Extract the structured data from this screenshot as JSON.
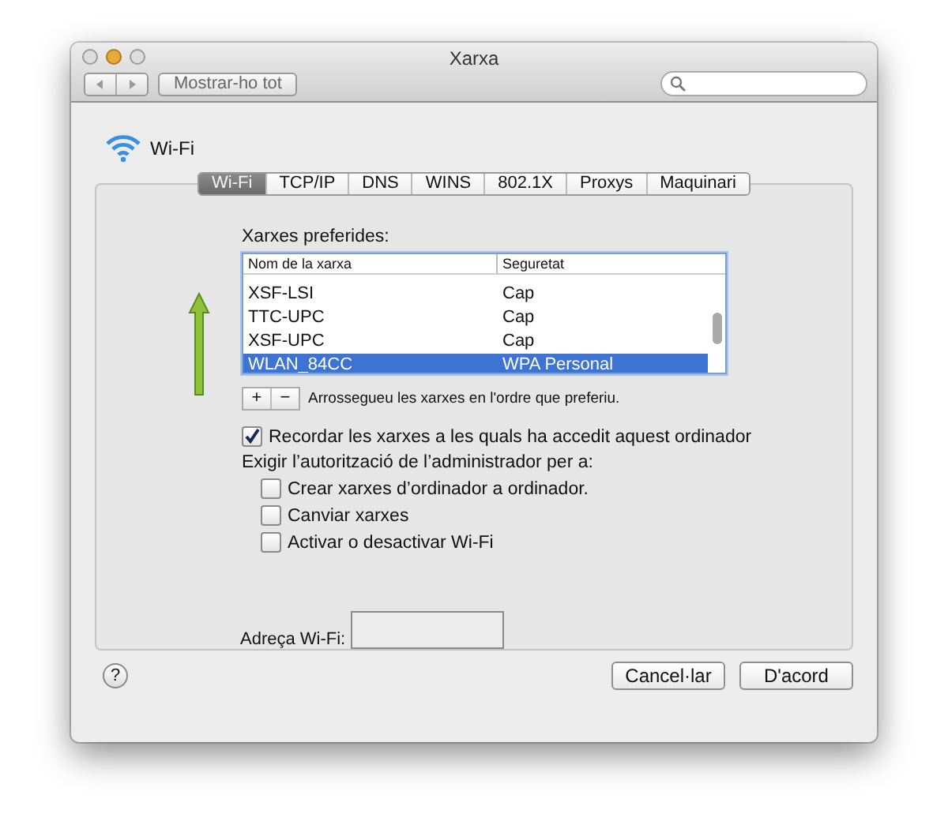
{
  "window": {
    "title": "Xarxa"
  },
  "toolbar": {
    "show_all": "Mostrar-ho tot"
  },
  "service": {
    "name": "Wi-Fi"
  },
  "tabs": [
    {
      "label": "Wi-Fi",
      "selected": true
    },
    {
      "label": "TCP/IP",
      "selected": false
    },
    {
      "label": "DNS",
      "selected": false
    },
    {
      "label": "WINS",
      "selected": false
    },
    {
      "label": "802.1X",
      "selected": false
    },
    {
      "label": "Proxys",
      "selected": false
    },
    {
      "label": "Maquinari",
      "selected": false
    }
  ],
  "preferred_networks": {
    "label": "Xarxes preferides:",
    "columns": [
      "Nom de la xarxa",
      "Seguretat"
    ],
    "rows": [
      {
        "name": "XSF-LSI",
        "security": "Cap",
        "selected": false
      },
      {
        "name": "TTC-UPC",
        "security": "Cap",
        "selected": false
      },
      {
        "name": "XSF-UPC",
        "security": "Cap",
        "selected": false
      },
      {
        "name": "WLAN_84CC",
        "security": "WPA Personal",
        "selected": true
      }
    ],
    "add": "+",
    "remove": "−",
    "hint": "Arrossegueu les xarxes en l'ordre que preferiu."
  },
  "remember": {
    "label": "Recordar les xarxes a les quals ha accedit aquest ordinador",
    "checked": true
  },
  "admin": {
    "label": "Exigir l’autorització de l’administrador per a:",
    "options": [
      {
        "label": "Crear xarxes d’ordinador a ordinador.",
        "checked": false
      },
      {
        "label": "Canviar xarxes",
        "checked": false
      },
      {
        "label": "Activar o desactivar Wi-Fi",
        "checked": false
      }
    ]
  },
  "address": {
    "label": "Adreça Wi-Fi:"
  },
  "help": "?",
  "buttons": [
    {
      "label": "Cancel·lar"
    },
    {
      "label": "D'acord"
    }
  ]
}
